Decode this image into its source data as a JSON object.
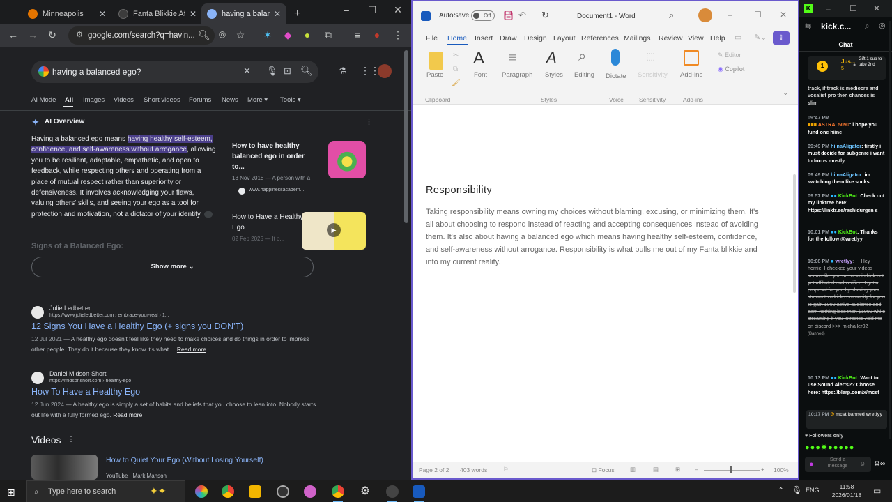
{
  "browser": {
    "tabs": [
      {
        "title": "Minneapolis",
        "color": "#e37400"
      },
      {
        "title": "Fanta Blikkie Afv",
        "color": "#3c3c3c"
      },
      {
        "title": "having a balance",
        "color": "#8ab4f8"
      }
    ],
    "new_tab": "+",
    "url": "google.com/search?q=havin...",
    "search_query": "having a balanced ego?",
    "filters": [
      "AI Mode",
      "All",
      "Images",
      "Videos",
      "Short videos",
      "Forums",
      "News",
      "More",
      "Tools"
    ],
    "ai_overview": {
      "heading": "AI Overview",
      "text_before": "Having a balanced ego means ",
      "text_highlight": "having healthy self-esteem, confidence, and self-awareness without arrogance",
      "text_after": ", allowing you to be resilient, adaptable, empathetic, and open to feedback, while respecting others and operating from a place of mutual respect rather than superiority or defensiveness. It involves acknowledging your flaws, valuing others' skills, and seeing your ego as a tool for protection and motivation, not a dictator of your identity.",
      "faded_heading": "Signs of a Balanced Ego:",
      "cards": [
        {
          "title": "How to have healthy balanced ego in order to...",
          "date": "13 Nov 2018 — A person with a strong and balanced ego...",
          "source": "www.happinessacadem..."
        },
        {
          "title": "How to Have a Healthy Ego",
          "date": "02 Feb 2025 — It o...",
          "source": ""
        }
      ],
      "show_more": "Show more"
    },
    "results": [
      {
        "source": "Julie Ledbetter",
        "url": "https://www.julieledbetter.com › embrace-your-real › 1...",
        "title": "12 Signs You Have a Healthy Ego (+ signs you DON'T)",
        "date": "12 Jul 2021",
        "snippet": " — A healthy ego doesn't feel like they need to make choices and do things in order to impress other people. They do it because they know it's what ...",
        "read_more": "Read more"
      },
      {
        "source": "Daniel Midson-Short",
        "url": "https://midsonshort.com › healthy-ego",
        "title": "How To Have a Healthy Ego",
        "date": "12 Jun 2024",
        "snippet": " — A healthy ego is simply a set of habits and beliefs that you choose to lean into. Nobody starts out life with a fully formed ego.",
        "read_more": "Read more"
      }
    ],
    "videos_heading": "Videos",
    "video": {
      "title": "How to Quiet Your Ego (Without Losing Yourself)",
      "channel": "YouTube · Mark Manson"
    }
  },
  "word": {
    "autosave": "AutoSave",
    "autosave_state": "Off",
    "doc_title": "Document1 - Word",
    "menu": [
      "File",
      "Home",
      "Insert",
      "Draw",
      "Design",
      "Layout",
      "References",
      "Mailings",
      "Review",
      "View",
      "Help"
    ],
    "ribbon": [
      "Paste",
      "Font",
      "Paragraph",
      "Styles",
      "Editing",
      "Dictate",
      "Sensitivity",
      "Add-ins",
      "Editor",
      "Copilot"
    ],
    "ribbon_groups": [
      "Clipboard",
      "Styles",
      "Voice",
      "Sensitivity",
      "Add-ins"
    ],
    "heading": "Responsibility",
    "body": "Taking responsibility means owning my choices without blaming, excusing, or minimizing them. It's all about choosing to respond instead of reacting and accepting consequences instead of avoiding them. It's also about having a balanced ego which means having healthy self-esteem, confidence, and self-awareness without arrogance. Responsibility is what pulls me out of my Fanta blikkie and into my current reality.",
    "status": {
      "page": "Page 2 of 2",
      "words": "403 words",
      "focus": "Focus",
      "zoom": "100%"
    }
  },
  "kick": {
    "channel": "kick.c...",
    "header": "Chat",
    "gift": {
      "user": "Jus...",
      "count": "5",
      "text": "Gift 1 sub to take 2nd"
    },
    "messages": [
      {
        "time": "",
        "user": "",
        "text": "track, if track is mediocre and vocalist pro then chances is slim"
      },
      {
        "time": "09:47 PM",
        "user": "ASTRAL5090",
        "text": ": i hope you fund one hiine"
      },
      {
        "time": "09:49 PM",
        "user": "hiinaAligator",
        "text": ": firstly i must decide for subgenre i want to focus mostly"
      },
      {
        "time": "09:49 PM",
        "user": "hiinaAligator",
        "text": ": im switching them like socks"
      },
      {
        "time": "09:57 PM",
        "user": "KickBot",
        "text": ": Check out my linktree here:",
        "link": "https://linktr.ee/rashidurgen s"
      },
      {
        "time": "10:01 PM",
        "user": "KickBot",
        "text": ": Thanks for the follow @wretlyy"
      },
      {
        "time": "10:08 PM",
        "user": "wretlyy",
        "text": ": ~~Hey homie, I checked your videos seems like you are new in kick not yet affiliated and verified. I got a proposal for you by sharing your stream to a kick community for you to gain 1000 active audience and earn nothing less than $1000 while streaming if you intrested Add me on discord >>> michaller02",
        "badge": "(Banned)"
      },
      {
        "time": "10:13 PM",
        "user": "KickBot",
        "text": ": Want to use Sound Alerts?? Choose here:",
        "link": "https://blerp.com/x/mcst"
      },
      {
        "time": "10:17 PM",
        "user": "",
        "text": "mcst banned wretlyy"
      }
    ],
    "followers_only": "Followers only",
    "send_placeholder": "Send a message"
  },
  "taskbar": {
    "search": "Type here to search",
    "lang": "ENG",
    "time": "11:58",
    "date": "2026/01/18"
  },
  "colors": {
    "accent_purple": "#6a5acd",
    "kick_green": "#53fc18",
    "link_blue": "#8ab4f8",
    "highlight": "#4b3f8a"
  }
}
